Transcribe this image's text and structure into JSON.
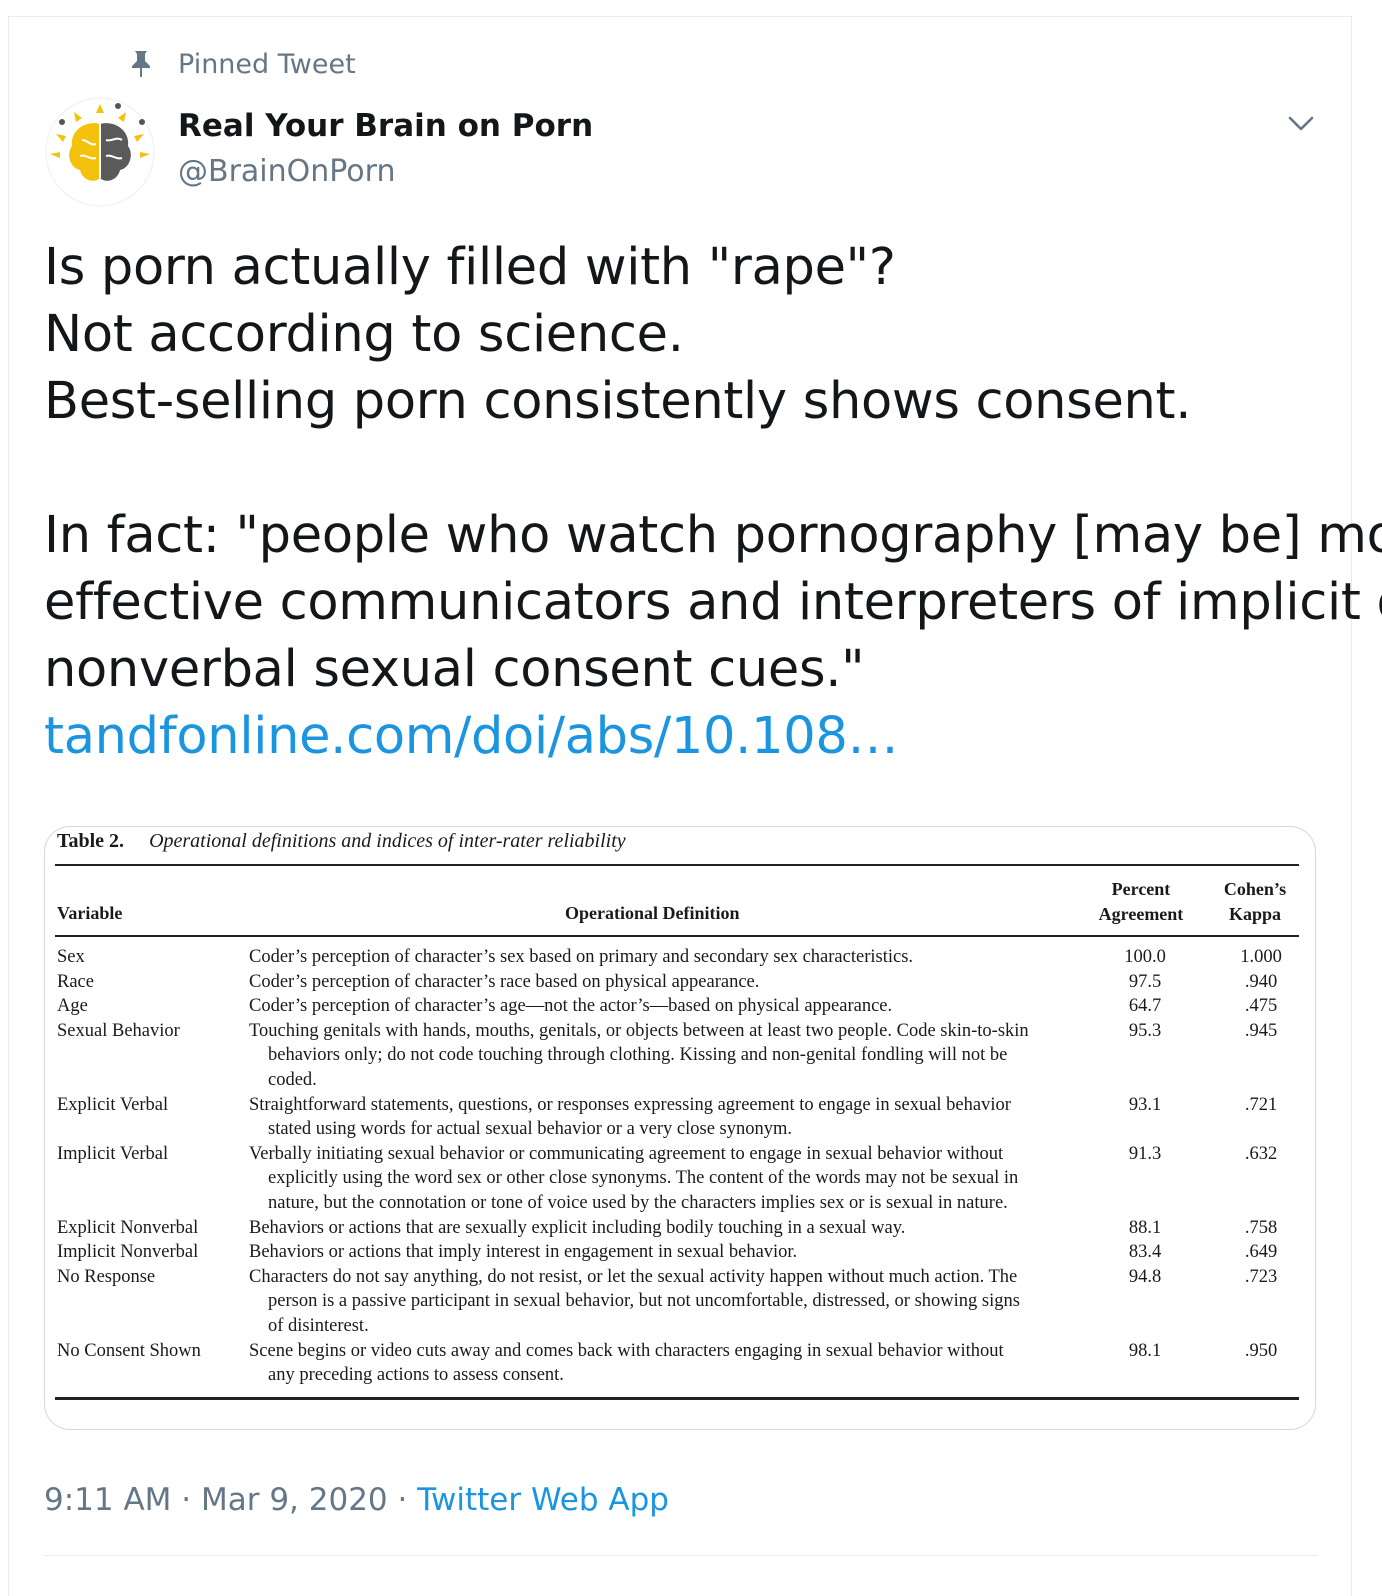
{
  "pinned_label": "Pinned Tweet",
  "author": {
    "name": "Real Your Brain on Porn",
    "handle": "@BrainOnPorn"
  },
  "tweet": {
    "lines": [
      "Is porn actually filled with \"rape\"?",
      "Not according to science.",
      "Best-selling porn consistently shows consent.",
      "In fact: \"people who watch pornography [may be] more",
      "effective communicators and interpreters of implicit or",
      "nonverbal sexual consent cues.\""
    ],
    "link": "tandfonline.com/doi/abs/10.108…"
  },
  "table": {
    "number": "Table 2.",
    "caption": "Operational definitions and indices of inter-rater reliability",
    "headers": {
      "variable": "Variable",
      "definition": "Operational Definition",
      "percent_1": "Percent",
      "percent_2": "Agreement",
      "kappa_1": "Cohen’s",
      "kappa_2": "Kappa"
    },
    "rows": [
      {
        "variable": "Sex",
        "definition": [
          "Coder’s perception of character’s sex based on primary and secondary sex characteristics."
        ],
        "percent": "100.0",
        "kappa": "1.000"
      },
      {
        "variable": "Race",
        "definition": [
          "Coder’s perception of character’s race based on physical appearance."
        ],
        "percent": "97.5",
        "kappa": ".940"
      },
      {
        "variable": "Age",
        "definition": [
          "Coder’s perception of character’s age—not the actor’s—based on physical appearance."
        ],
        "percent": "64.7",
        "kappa": ".475"
      },
      {
        "variable": "Sexual Behavior",
        "definition": [
          "Touching genitals with hands, mouths, genitals, or objects between at least two people. Code skin-to-skin",
          "behaviors only; do not code touching through clothing. Kissing and non-genital fondling will not be",
          "coded."
        ],
        "percent": "95.3",
        "kappa": ".945"
      },
      {
        "variable": "Explicit Verbal",
        "definition": [
          "Straightforward statements, questions, or responses expressing agreement to engage in sexual behavior",
          "stated using words for actual sexual behavior or a very close synonym."
        ],
        "percent": "93.1",
        "kappa": ".721"
      },
      {
        "variable": "Implicit Verbal",
        "definition": [
          "Verbally initiating sexual behavior or communicating agreement to engage in sexual behavior without",
          "explicitly using the word sex or other close synonyms. The content of the words may not be sexual in",
          "nature, but the connotation or tone of voice used by the characters implies sex or is sexual in nature."
        ],
        "percent": "91.3",
        "kappa": ".632"
      },
      {
        "variable": "Explicit Nonverbal",
        "definition": [
          "Behaviors or actions that are sexually explicit including bodily touching in a sexual way."
        ],
        "percent": "88.1",
        "kappa": ".758"
      },
      {
        "variable": "Implicit Nonverbal",
        "definition": [
          "Behaviors or actions that imply interest in engagement in sexual behavior."
        ],
        "percent": "83.4",
        "kappa": ".649"
      },
      {
        "variable": "No Response",
        "definition": [
          "Characters do not say anything, do not resist, or let the sexual activity happen without much action. The",
          "person is a passive participant in sexual behavior, but not uncomfortable, distressed, or showing signs",
          "of disinterest."
        ],
        "percent": "94.8",
        "kappa": ".723"
      },
      {
        "variable": "No Consent Shown",
        "definition": [
          "Scene begins or video cuts away and comes back with characters engaging in sexual behavior without",
          "any preceding actions to assess consent."
        ],
        "percent": "98.1",
        "kappa": ".950"
      }
    ]
  },
  "meta": {
    "time": "9:11 AM",
    "date": "Mar 9, 2020",
    "separator": " · ",
    "app": "Twitter Web App"
  },
  "colors": {
    "link": "#1b95e0",
    "secondary": "#657786",
    "text": "#14171a",
    "brand_yellow": "#f4c20d",
    "brand_gray": "#5a5a5a"
  },
  "icons": [
    "pin-icon",
    "chevron-down-icon",
    "brain-logo"
  ]
}
